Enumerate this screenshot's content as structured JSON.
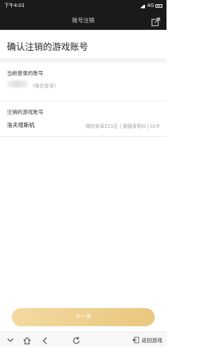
{
  "status_bar": {
    "time": "下午4:01",
    "network": "4G",
    "network_badge": "4G"
  },
  "header": {
    "title": "账号注销",
    "share_icon": "share-icon"
  },
  "page": {
    "heading": "确认注销的游戏账号"
  },
  "current_account": {
    "label": "当前登录的账号",
    "login_type": "(微信登录)"
  },
  "game_account": {
    "label": "注销的游戏账号",
    "name": "洛夫塔斯机",
    "info": "微信安卓221区 | 倔强青铜III | LV.6"
  },
  "actions": {
    "next_label": "下一步"
  },
  "nav_bar": {
    "items": [
      "menu-icon",
      "home-icon",
      "back-icon",
      "refresh-icon"
    ],
    "return_label": "返回游戏"
  },
  "colors": {
    "bar_dark": "#1a1a1a",
    "button_gold": "#eccc87",
    "text_muted": "#a0a0a0"
  }
}
